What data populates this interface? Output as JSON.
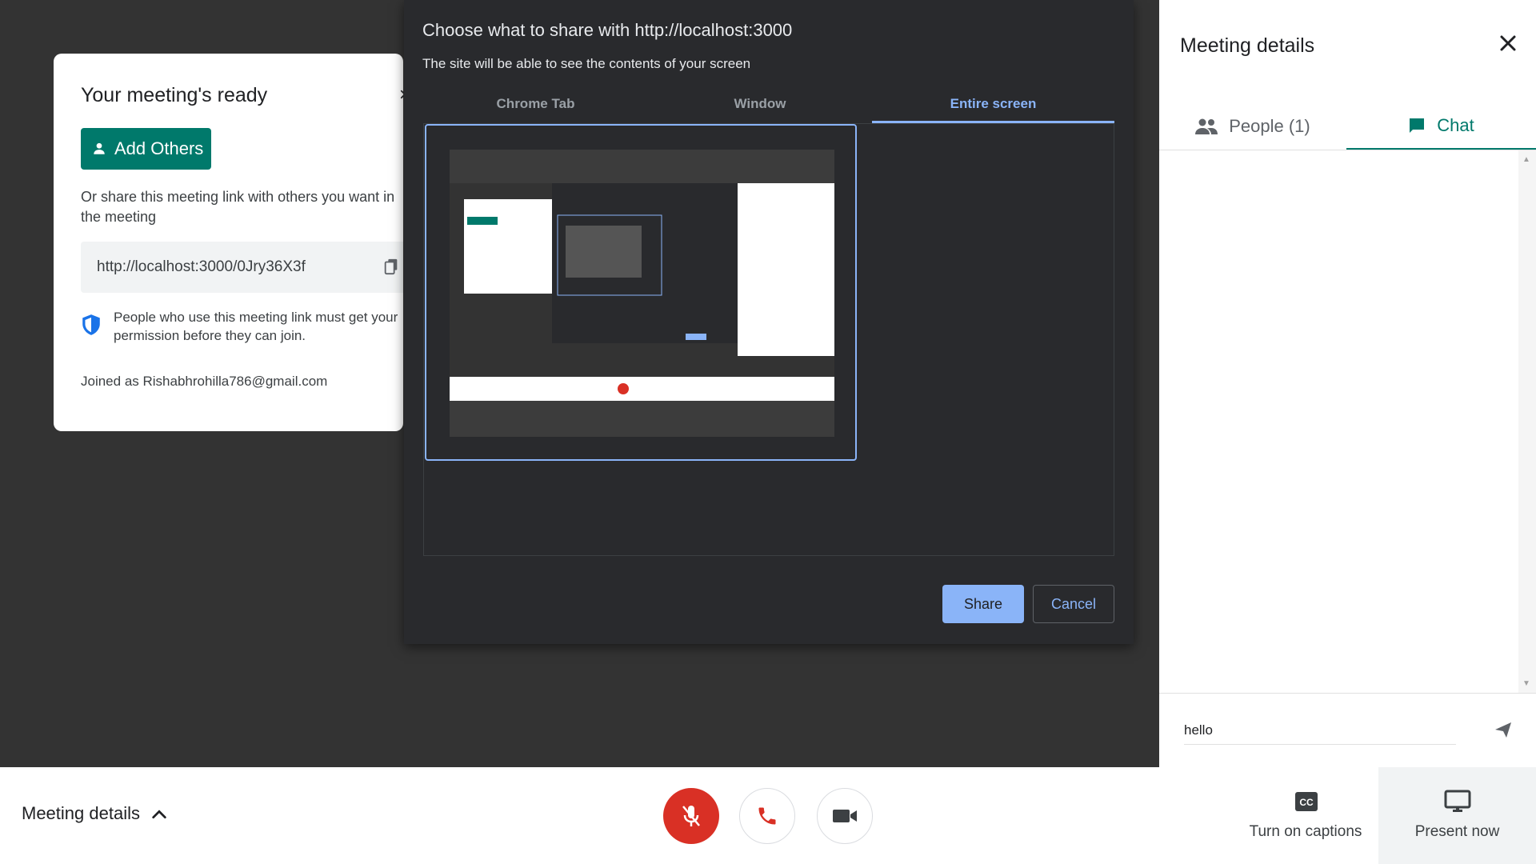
{
  "ready_card": {
    "title": "Your meeting's ready",
    "close_glyph": "×",
    "add_others_label": "Add Others",
    "share_text": "Or share this meeting link with others you want in the meeting",
    "meeting_link": "http://localhost:3000/0Jry36X3f",
    "permission_text": "People who use this meeting link must get your permission before they can join.",
    "joined_text": "Joined as Rishabhrohilla786@gmail.com"
  },
  "share_dialog": {
    "title": "Choose what to share with http://localhost:3000",
    "subtitle": "The site will be able to see the contents of your screen",
    "tabs": [
      {
        "label": "Chrome Tab",
        "selected": false
      },
      {
        "label": "Window",
        "selected": false
      },
      {
        "label": "Entire screen",
        "selected": true
      }
    ],
    "share_label": "Share",
    "cancel_label": "Cancel",
    "accent_color": "#8ab4f8"
  },
  "side_panel": {
    "title": "Meeting details",
    "tabs": {
      "people_label": "People (1)",
      "chat_label": "Chat"
    },
    "chat_input_value": "hello",
    "accent_color": "#00796b"
  },
  "bottom_bar": {
    "meeting_details_label": "Meeting details",
    "captions_label": "Turn on captions",
    "captions_icon_text": "CC",
    "present_label": "Present now",
    "mic_color": "#d93025",
    "hangup_color": "#d93025"
  }
}
